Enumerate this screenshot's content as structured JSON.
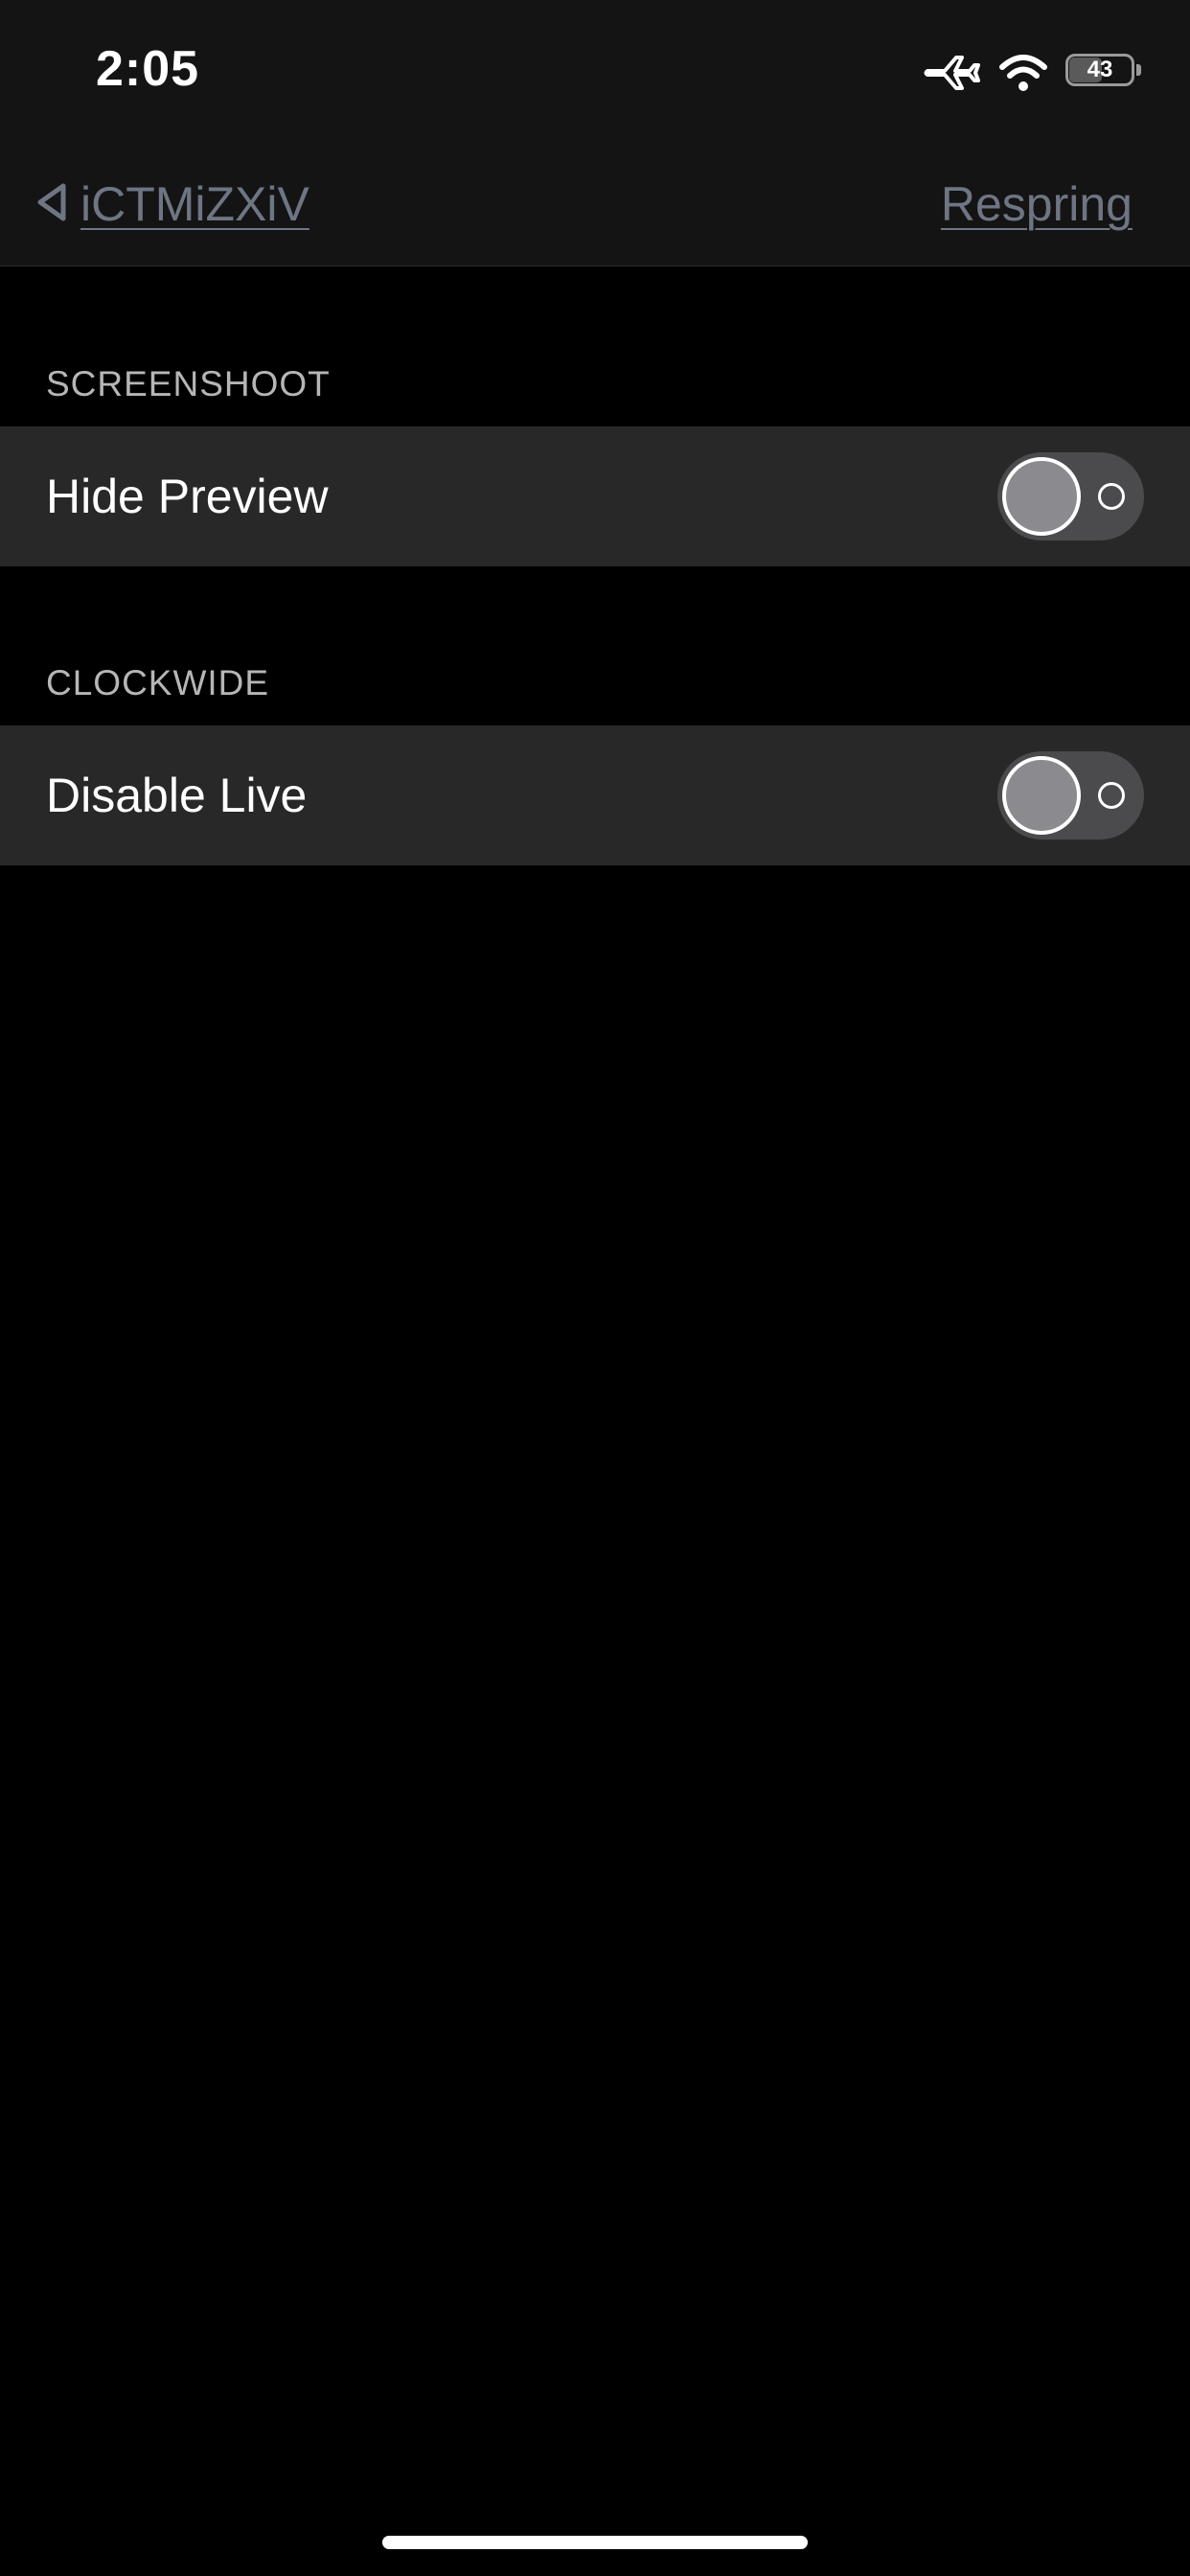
{
  "status_bar": {
    "time": "2:05",
    "battery_level": "43",
    "icons": [
      "airplane-icon",
      "wifi-icon",
      "battery-icon"
    ]
  },
  "nav": {
    "back_label": "iCTMiZXiV",
    "back_icon": "back-triangle-icon",
    "action_label": "Respring",
    "link_color": "#6e7583"
  },
  "sections": [
    {
      "header": "SCREENSHOOT",
      "rows": [
        {
          "label": "Hide Preview",
          "toggle_on": false
        }
      ]
    },
    {
      "header": "CLOCKWIDE",
      "rows": [
        {
          "label": "Disable Live",
          "toggle_on": false
        }
      ]
    }
  ],
  "colors": {
    "background": "#000000",
    "bar_background": "#141414",
    "cell_background": "#282828",
    "toggle_off_track": "#4b4b4d"
  }
}
